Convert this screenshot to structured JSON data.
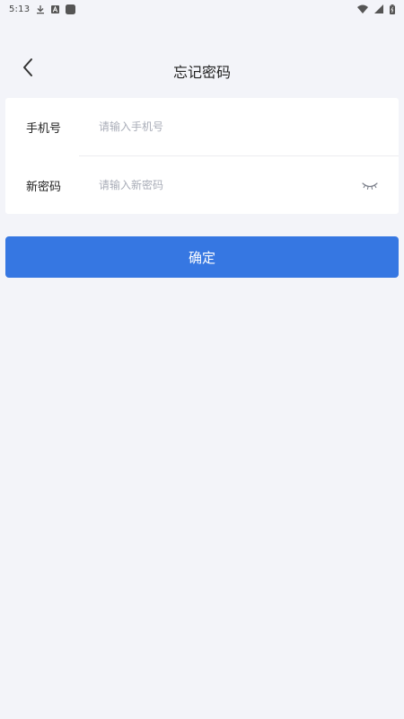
{
  "status_bar": {
    "time": "5:13",
    "icons": [
      "download-icon",
      "font-a-icon",
      "app-square-icon",
      "wifi-icon",
      "signal-icon",
      "battery-icon"
    ]
  },
  "header": {
    "back_icon": "chevron-left-icon",
    "title": "忘记密码"
  },
  "form": {
    "phone": {
      "label": "手机号",
      "value": "",
      "placeholder": "请输入手机号"
    },
    "new_password": {
      "label": "新密码",
      "value": "",
      "placeholder": "请输入新密码",
      "toggle_icon": "eye-closed-icon"
    }
  },
  "confirm_button": {
    "label": "确定",
    "color": "#3677e2"
  },
  "colors": {
    "background": "#f3f4f9",
    "card": "#ffffff",
    "placeholder": "#a9adb8",
    "accent": "#3677e2"
  }
}
